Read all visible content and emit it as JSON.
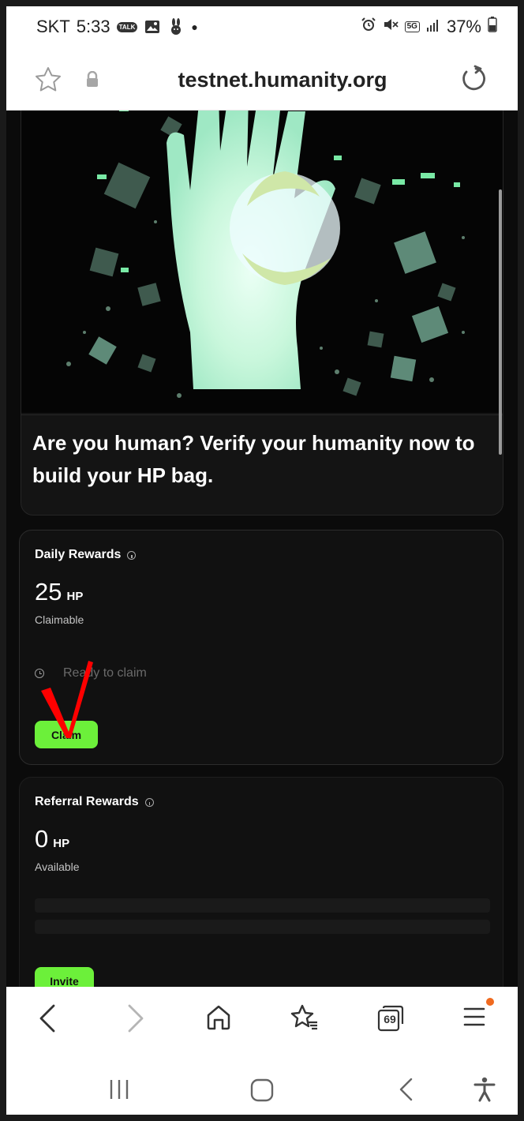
{
  "status_bar": {
    "carrier": "SKT",
    "time": "5:33",
    "talk_badge": "TALK",
    "network": "5G",
    "battery": "37%"
  },
  "browser": {
    "url": "testnet.humanity.org",
    "tab_count": "69"
  },
  "hero": {
    "headline": "Are you human? Verify your humanity now to build your HP bag."
  },
  "daily_rewards": {
    "title": "Daily Rewards",
    "amount": "25",
    "unit": "HP",
    "status": "Claimable",
    "timer_text": "Ready to claim",
    "button": "Claim"
  },
  "referral_rewards": {
    "title": "Referral Rewards",
    "amount": "0",
    "unit": "HP",
    "status": "Available",
    "button": "Invite"
  },
  "colors": {
    "accent_green": "#6cf03a",
    "page_background": "#0b0b0b",
    "annotation_red": "#ff0000",
    "notification_dot": "#f06a1f"
  },
  "icons": [
    "chat-icon",
    "gallery-icon",
    "rabbit-icon",
    "alarm-icon",
    "mute-icon",
    "signal-icon",
    "battery-icon",
    "bookmark-star-icon",
    "lock-icon",
    "reload-icon",
    "back-arrow-icon",
    "forward-arrow-icon",
    "home-icon",
    "bookmarks-icon",
    "tabs-icon",
    "menu-icon",
    "recent-apps-icon",
    "home-button-icon",
    "nav-back-icon",
    "accessibility-icon",
    "info-icon",
    "clock-icon"
  ]
}
